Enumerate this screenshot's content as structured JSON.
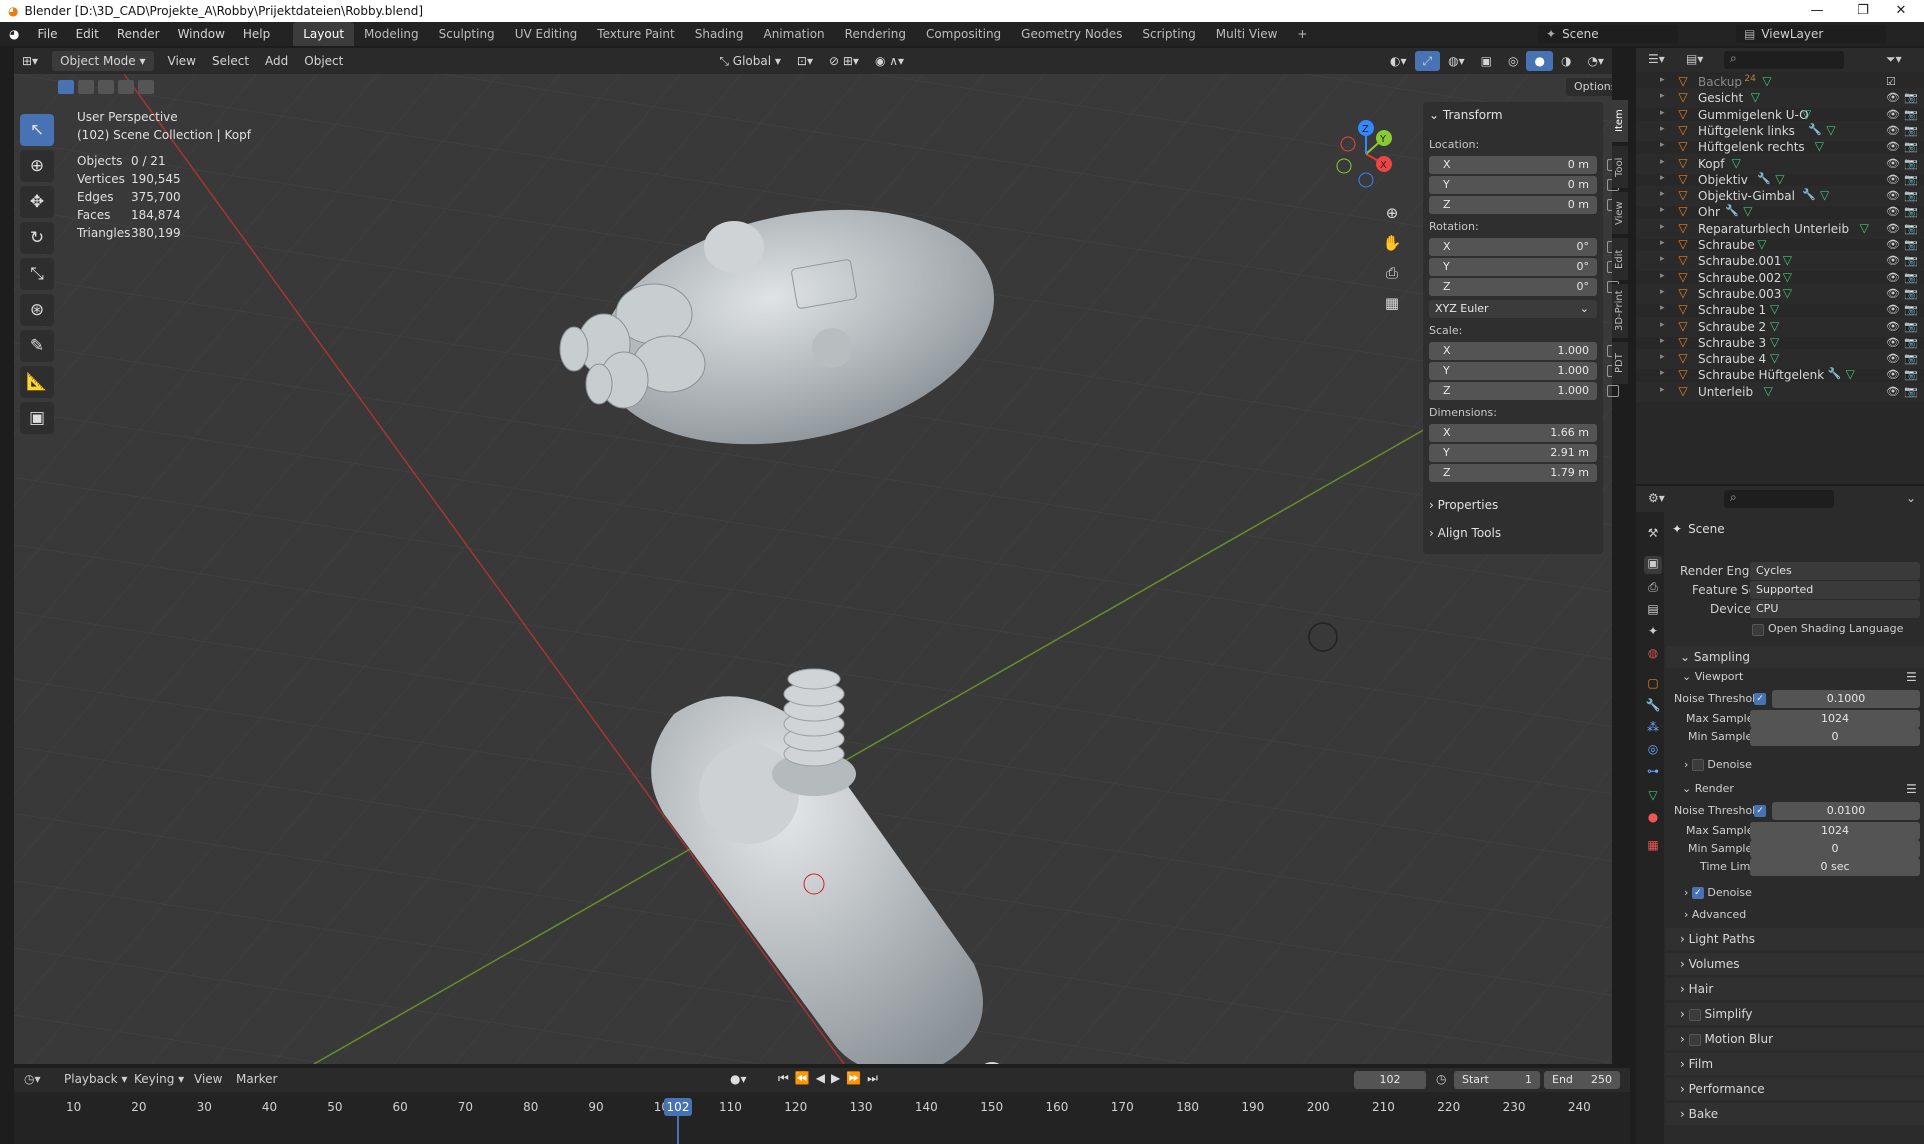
{
  "window": {
    "title": "Blender [D:\\3D_CAD\\Projekte_A\\Robby\\Prijektdateien\\Robby.blend]",
    "min": "—",
    "max": "❐",
    "close": "✕"
  },
  "menu": [
    "File",
    "Edit",
    "Render",
    "Window",
    "Help"
  ],
  "workspaces": [
    "Layout",
    "Modeling",
    "Sculpting",
    "UV Editing",
    "Texture Paint",
    "Shading",
    "Animation",
    "Rendering",
    "Compositing",
    "Geometry Nodes",
    "Scripting",
    "Multi View",
    "+"
  ],
  "scene_field": "Scene",
  "viewlayer_field": "ViewLayer",
  "header": {
    "mode": "Object Mode",
    "menus": [
      "View",
      "Select",
      "Add",
      "Object"
    ],
    "orientation": "Global",
    "options": "Options"
  },
  "viewport": {
    "perspective": "User Perspective",
    "collection": "(102) Scene Collection | Kopf",
    "stats": [
      {
        "label": "Objects",
        "value": "0 / 21"
      },
      {
        "label": "Vertices",
        "value": "190,545"
      },
      {
        "label": "Edges",
        "value": "375,700"
      },
      {
        "label": "Faces",
        "value": "184,874"
      },
      {
        "label": "Triangles",
        "value": "380,199"
      }
    ],
    "gizmo": {
      "x": "X",
      "y": "Y",
      "z": "Z"
    }
  },
  "npanel": {
    "transform": "Transform",
    "location_label": "Location:",
    "location": [
      {
        "ax": "X",
        "v": "0 m"
      },
      {
        "ax": "Y",
        "v": "0 m"
      },
      {
        "ax": "Z",
        "v": "0 m"
      }
    ],
    "rotation_label": "Rotation:",
    "rotation": [
      {
        "ax": "X",
        "v": "0°"
      },
      {
        "ax": "Y",
        "v": "0°"
      },
      {
        "ax": "Z",
        "v": "0°"
      }
    ],
    "rotation_mode": "XYZ Euler",
    "scale_label": "Scale:",
    "scale": [
      {
        "ax": "X",
        "v": "1.000"
      },
      {
        "ax": "Y",
        "v": "1.000"
      },
      {
        "ax": "Z",
        "v": "1.000"
      }
    ],
    "dimensions_label": "Dimensions:",
    "dimensions": [
      {
        "ax": "X",
        "v": "1.66 m"
      },
      {
        "ax": "Y",
        "v": "2.91 m"
      },
      {
        "ax": "Z",
        "v": "1.79 m"
      }
    ],
    "properties": "Properties",
    "align_tools": "Align Tools",
    "tabs": [
      "Item",
      "Tool",
      "View",
      "Edit",
      "3D-Print",
      "PDT"
    ]
  },
  "outliner": {
    "items": [
      {
        "name": "Backup",
        "badge": "24",
        "dim": true
      },
      {
        "name": "Gesicht"
      },
      {
        "name": "Gummigelenk U-O"
      },
      {
        "name": "Hüftgelenk links",
        "mod": true
      },
      {
        "name": "Hüftgelenk rechts"
      },
      {
        "name": "Kopf"
      },
      {
        "name": "Objektiv",
        "mod": true
      },
      {
        "name": "Objektiv-Gimbal",
        "mod": true
      },
      {
        "name": "Ohr",
        "mod": true
      },
      {
        "name": "Reparaturblech Unterleib"
      },
      {
        "name": "Schraube"
      },
      {
        "name": "Schraube.001"
      },
      {
        "name": "Schraube.002"
      },
      {
        "name": "Schraube.003"
      },
      {
        "name": "Schraube 1"
      },
      {
        "name": "Schraube 2"
      },
      {
        "name": "Schraube 3"
      },
      {
        "name": "Schraube 4"
      },
      {
        "name": "Schraube Hüftgelenk",
        "mod": true
      },
      {
        "name": "Unterleib"
      }
    ]
  },
  "props": {
    "context": "Scene",
    "render_engine_label": "Render Engine",
    "render_engine": "Cycles",
    "feature_set_label": "Feature Set",
    "feature_set": "Supported",
    "device_label": "Device",
    "device": "CPU",
    "osl": "Open Shading Language",
    "sampling": "Sampling",
    "viewport": "Viewport",
    "noise_threshold": "Noise Threshold",
    "vp_noise": "0.1000",
    "max_samples": "Max Samples",
    "vp_max": "1024",
    "min_samples": "Min Samples",
    "vp_min": "0",
    "denoise": "Denoise",
    "render": "Render",
    "r_noise": "0.0100",
    "r_max": "1024",
    "r_min": "0",
    "time_limit": "Time Limit",
    "r_time": "0 sec",
    "advanced": "Advanced",
    "sections": [
      "Light Paths",
      "Volumes",
      "Hair",
      "Simplify",
      "Motion Blur",
      "Film",
      "Performance",
      "Bake"
    ]
  },
  "timeline": {
    "menus": [
      "Playback",
      "Keying",
      "View",
      "Marker"
    ],
    "current": "102",
    "start_label": "Start",
    "start": "1",
    "end_label": "End",
    "end": "250",
    "ticks": [
      "10",
      "20",
      "30",
      "40",
      "50",
      "60",
      "70",
      "80",
      "90",
      "100",
      "110",
      "120",
      "130",
      "140",
      "150",
      "160",
      "170",
      "180",
      "190",
      "200",
      "210",
      "220",
      "230",
      "240"
    ]
  }
}
